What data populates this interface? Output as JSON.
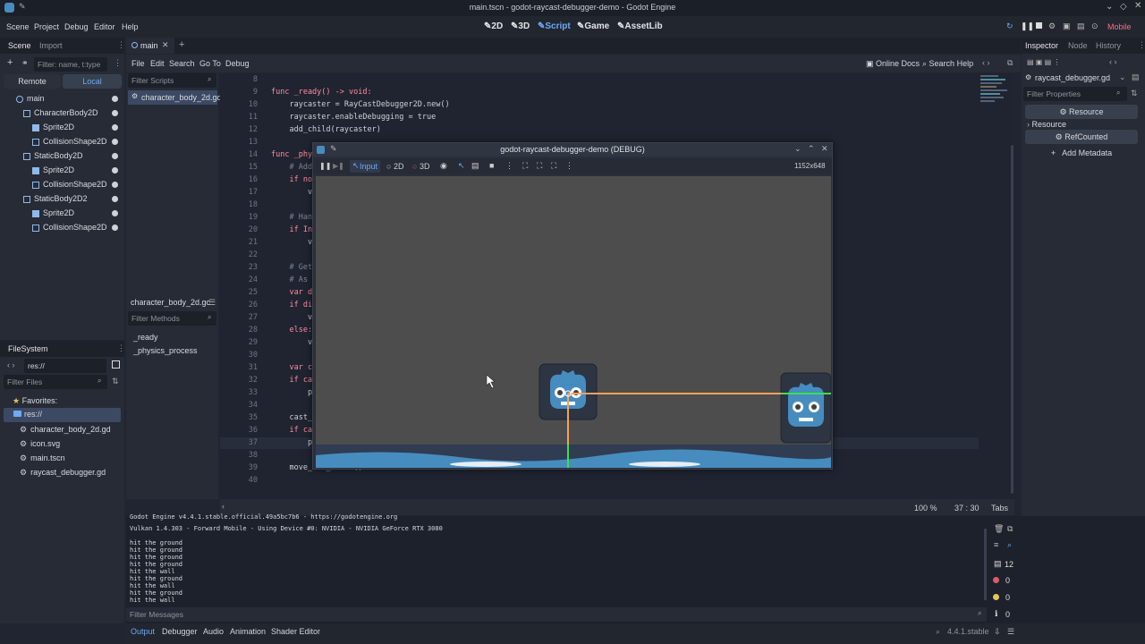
{
  "window": {
    "title": "main.tscn - godot-raycast-debugger-demo - Godot Engine"
  },
  "menu": [
    "Scene",
    "Project",
    "Debug",
    "Editor",
    "Help"
  ],
  "workspaces": [
    {
      "label": "2D",
      "active": false
    },
    {
      "label": "3D",
      "active": false
    },
    {
      "label": "Script",
      "active": true
    },
    {
      "label": "Game",
      "active": false
    },
    {
      "label": "AssetLib",
      "active": false
    }
  ],
  "renderer": "Mobile",
  "scene_dock": {
    "tabs": [
      "Scene",
      "Import"
    ],
    "filter_placeholder": "Filter: name, t:type",
    "remote_label": "Remote",
    "local_label": "Local",
    "tree": [
      {
        "label": "main",
        "depth": 0
      },
      {
        "label": "CharacterBody2D",
        "depth": 1
      },
      {
        "label": "Sprite2D",
        "depth": 2
      },
      {
        "label": "CollisionShape2D",
        "depth": 2
      },
      {
        "label": "StaticBody2D",
        "depth": 1
      },
      {
        "label": "Sprite2D",
        "depth": 2
      },
      {
        "label": "CollisionShape2D",
        "depth": 2
      },
      {
        "label": "StaticBody2D2",
        "depth": 1
      },
      {
        "label": "Sprite2D",
        "depth": 2
      },
      {
        "label": "CollisionShape2D",
        "depth": 2
      }
    ]
  },
  "filesystem": {
    "title": "FileSystem",
    "path": "res://",
    "filter_placeholder": "Filter Files",
    "favorites_label": "Favorites:",
    "root": "res://",
    "files": [
      "character_body_2d.gd",
      "icon.svg",
      "main.tscn",
      "raycast_debugger.gd"
    ]
  },
  "script_editor": {
    "tab": "main",
    "menu": [
      "File",
      "Edit",
      "Search",
      "Go To",
      "Debug"
    ],
    "online_docs": "Online Docs",
    "search_help": "Search Help",
    "filter_scripts": "Filter Scripts",
    "scripts": [
      "character_body_2d.gd"
    ],
    "current_script_label": "character_body_2d.gc",
    "filter_methods": "Filter Methods",
    "methods": [
      "_ready",
      "_physics_process"
    ],
    "zoom": "100 %",
    "cursor": "37 :  30",
    "indent": "Tabs"
  },
  "code_lines": [
    {
      "n": "8",
      "text": ""
    },
    {
      "n": "9",
      "text": "func _ready() -> void:"
    },
    {
      "n": "10",
      "text": "    raycaster = RayCastDebugger2D.new()"
    },
    {
      "n": "11",
      "text": "    raycaster.enableDebugging = true"
    },
    {
      "n": "12",
      "text": "    add_child(raycaster)"
    },
    {
      "n": "13",
      "text": ""
    },
    {
      "n": "14",
      "text": "func _phys"
    },
    {
      "n": "15",
      "text": "    # Add"
    },
    {
      "n": "16",
      "text": "    if not"
    },
    {
      "n": "17",
      "text": "        ve"
    },
    {
      "n": "18",
      "text": ""
    },
    {
      "n": "19",
      "text": "    # Hand"
    },
    {
      "n": "20",
      "text": "    if Inp"
    },
    {
      "n": "21",
      "text": "        ve"
    },
    {
      "n": "22",
      "text": ""
    },
    {
      "n": "23",
      "text": "    # Get"
    },
    {
      "n": "24",
      "text": "    # As g"
    },
    {
      "n": "25",
      "text": "    var di"
    },
    {
      "n": "26",
      "text": "    if dir"
    },
    {
      "n": "27",
      "text": "        ve"
    },
    {
      "n": "28",
      "text": "    else:"
    },
    {
      "n": "29",
      "text": "        ve"
    },
    {
      "n": "30",
      "text": ""
    },
    {
      "n": "31",
      "text": "    var ca"
    },
    {
      "n": "32",
      "text": "    if cas"
    },
    {
      "n": "33",
      "text": "        pr"
    },
    {
      "n": "34",
      "text": ""
    },
    {
      "n": "35",
      "text": "    cast_r"
    },
    {
      "n": "36",
      "text": "    if cas"
    },
    {
      "n": "37",
      "text": "        pr"
    },
    {
      "n": "38",
      "text": ""
    },
    {
      "n": "39",
      "text": "    move_and_slide()"
    },
    {
      "n": "40",
      "text": ""
    }
  ],
  "game_window": {
    "title": "godot-raycast-debugger-demo (DEBUG)",
    "input_label": "Input",
    "mode_2d": "2D",
    "mode_3d": "3D",
    "resolution": "1152x648"
  },
  "inspector": {
    "tabs": [
      "Inspector",
      "Node",
      "History"
    ],
    "file": "raycast_debugger.gd",
    "filter_placeholder": "Filter Properties",
    "resource_btn": "Resource",
    "resource_section": "Resource",
    "refcounted_btn": "RefCounted",
    "add_metadata": "Add Metadata"
  },
  "output": {
    "lines": [
      "Godot Engine v4.4.1.stable.official.49a5bc7b6 - https://godotengine.org",
      "Vulkan 1.4.303 - Forward Mobile - Using Device #0: NVIDIA - NVIDIA GeForce RTX 3080",
      "",
      "hit the ground",
      "hit the ground",
      "hit the ground",
      "hit the ground",
      "hit the wall",
      "hit the ground",
      "hit the wall",
      "hit the ground",
      "hit the wall"
    ],
    "filter_placeholder": "Filter Messages",
    "counts": {
      "messages": "12",
      "errors": "0",
      "warnings": "0",
      "info": "0"
    }
  },
  "bottom_tabs": [
    "Output",
    "Debugger",
    "Audio",
    "Animation",
    "Shader Editor"
  ],
  "version": "4.4.1.stable",
  "colors": {
    "accent": "#6fa9f5",
    "ray_line": "#f6a25b",
    "ray_hit": "#3ee04c",
    "ground": "#478cbf"
  }
}
